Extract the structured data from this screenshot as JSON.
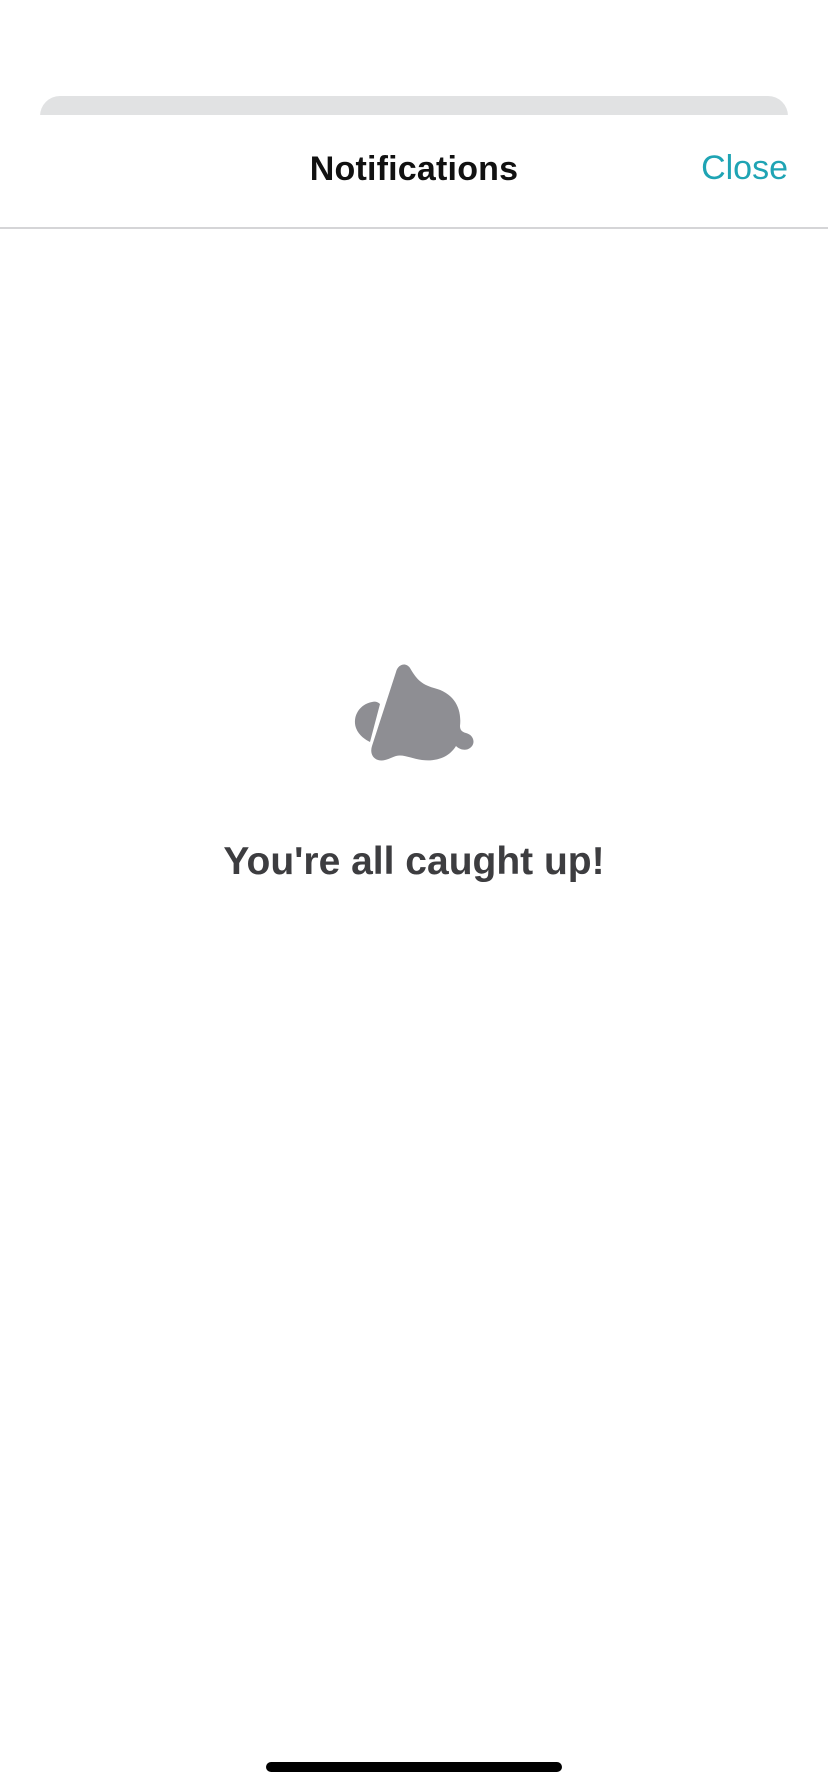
{
  "header": {
    "title": "Notifications",
    "close_label": "Close"
  },
  "empty_state": {
    "icon": "bell-slash-icon",
    "message": "You're all caught up!"
  },
  "colors": {
    "accent": "#1fa4b4",
    "icon_gray": "#8e8e93",
    "text_dark": "#3d3d40",
    "divider": "#d5d5d7"
  }
}
